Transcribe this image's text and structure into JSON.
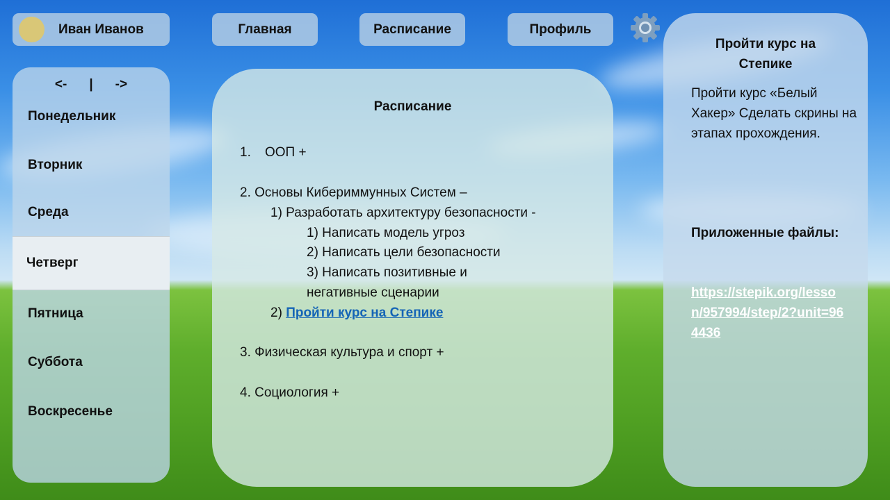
{
  "header": {
    "user_name": "Иван Иванов",
    "nav": {
      "home": "Главная",
      "schedule": "Расписание",
      "profile": "Профиль"
    }
  },
  "sidebar": {
    "prev": "<-",
    "separator": "|",
    "next": "->",
    "days": [
      "Понедельник",
      "Вторник",
      "Среда",
      "Четверг",
      "Пятница",
      "Суббота",
      "Воскресенье"
    ],
    "active_day": "Четверг"
  },
  "schedule": {
    "title": "Расписание",
    "item1_num": "1.",
    "item1_text": "ООП +",
    "item2": "2. Основы Кибериммунных Систем –",
    "item2_sub1": "1) Разработать архитектуру безопасности -",
    "item2_sub1_a": "1) Написать модель угроз",
    "item2_sub1_b": "2) Написать цели безопасности",
    "item2_sub1_c1": "3) Написать позитивные и",
    "item2_sub1_c2": "негативные сценарии",
    "item2_sub2_num": "2)",
    "item2_sub2_link": "Пройти курс на Степике",
    "item3": "3. Физическая культура и спорт +",
    "item4": "4. Социология +"
  },
  "task": {
    "title_line1": "Пройти курс на",
    "title_line2": "Степике",
    "description": "Пройти курс «Белый Хакер» Сделать скрины на этапах прохождения.",
    "files_label": "Приложенные файлы:",
    "file_link": "https://stepik.org/lesson/957994/step/2?unit=964436"
  },
  "colors": {
    "link": "#1565b6",
    "active_day_bg": "#e8eef2",
    "avatar": "#d9c777"
  }
}
